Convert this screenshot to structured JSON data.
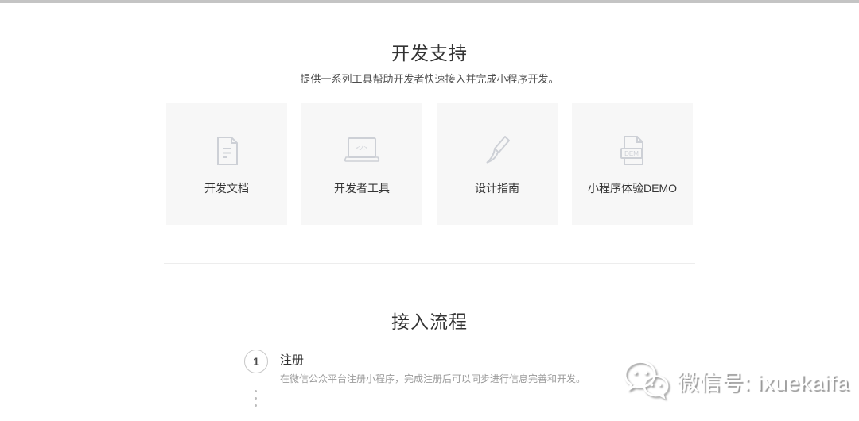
{
  "window": {
    "top_border_color": "#c4c4c4"
  },
  "dev_support": {
    "title": "开发支持",
    "subtitle": "提供一系列工具帮助开发者快速接入并完成小程序开发。",
    "cards": [
      {
        "label": "开发文档",
        "icon": "document-icon"
      },
      {
        "label": "开发者工具",
        "icon": "laptop-code-icon",
        "glyph": "</>"
      },
      {
        "label": "设计指南",
        "icon": "paint-brush-icon"
      },
      {
        "label": "小程序体验DEMO",
        "icon": "demo-file-icon",
        "badge": "DEM"
      }
    ]
  },
  "access_process": {
    "title": "接入流程",
    "steps": [
      {
        "number": "1",
        "title": "注册",
        "description": "在微信公众平台注册小程序，完成注册后可以同步进行信息完善和开发。"
      }
    ]
  },
  "watermark": {
    "icon": "wechat-logo",
    "text": "微信号: ixuekaifa"
  },
  "colors": {
    "card_background": "#f7f7f7",
    "icon_stroke": "#cdd0d6",
    "title_text": "#333333",
    "muted_text": "#9b9b9b",
    "divider": "#ededed"
  }
}
